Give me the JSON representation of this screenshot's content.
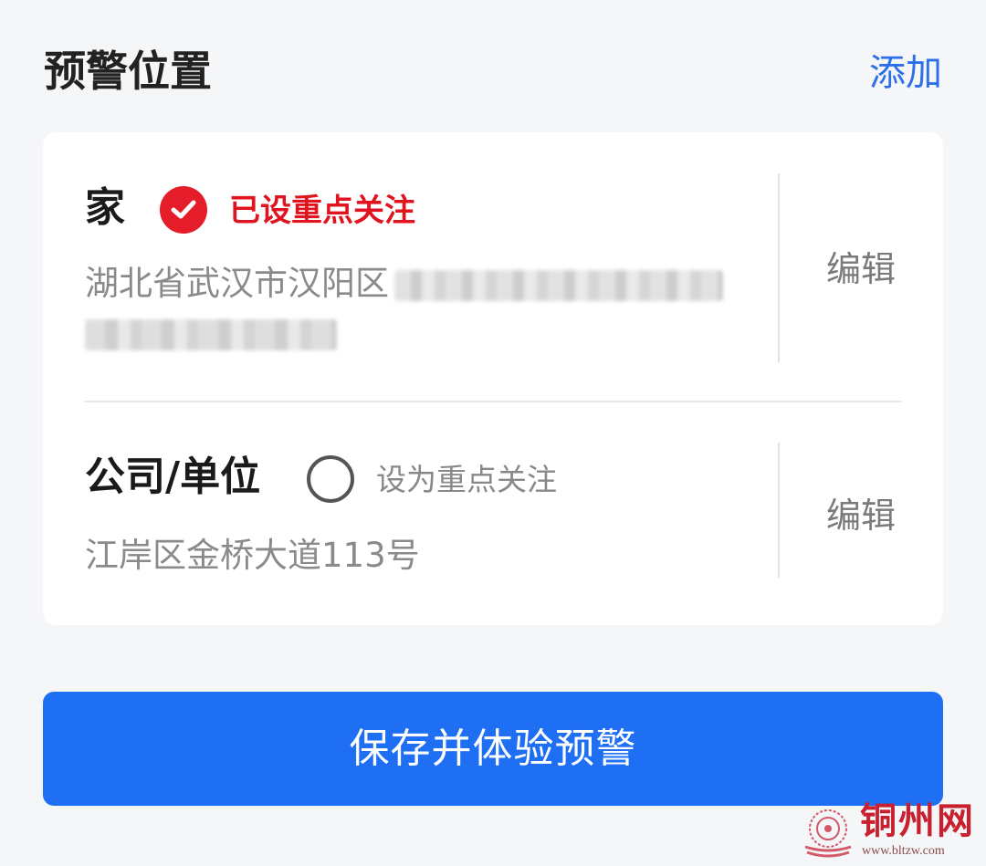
{
  "header": {
    "title": "预警位置",
    "add_label": "添加"
  },
  "locations": [
    {
      "name": "家",
      "focus_checked": true,
      "focus_label": "已设重点关注",
      "address_visible": "湖北省武汉市汉阳区",
      "edit_label": "编辑"
    },
    {
      "name": "公司/单位",
      "focus_checked": false,
      "focus_label": "设为重点关注",
      "address_visible": "江岸区金桥大道113号",
      "edit_label": "编辑"
    }
  ],
  "save_button_label": "保存并体验预警",
  "watermark": {
    "text": "铜州网",
    "url": "www.bltzw.com"
  },
  "colors": {
    "accent": "#1e6ff4",
    "link": "#2d6fe8",
    "focus_red": "#e51d2b",
    "background": "#f5f6f8"
  }
}
